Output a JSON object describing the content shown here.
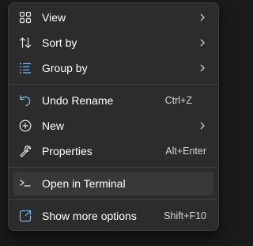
{
  "menu": {
    "items": [
      {
        "label": "View",
        "icon": "grid-view-icon"
      },
      {
        "label": "Sort by",
        "icon": "sort-arrows-icon"
      },
      {
        "label": "Group by",
        "icon": "group-list-icon"
      },
      {
        "label": "Undo Rename",
        "icon": "undo-icon",
        "shortcut": "Ctrl+Z"
      },
      {
        "label": "New",
        "icon": "new-plus-icon"
      },
      {
        "label": "Properties",
        "icon": "wrench-icon",
        "shortcut": "Alt+Enter"
      },
      {
        "label": "Open in Terminal",
        "icon": "terminal-icon"
      },
      {
        "label": "Show more options",
        "icon": "share-expand-icon",
        "shortcut": "Shift+F10"
      }
    ]
  },
  "colors": {
    "accent": "#7fb3e8",
    "menu_background": "#2c2c2c",
    "hover_background": "#383838",
    "text": "#ffffff"
  }
}
